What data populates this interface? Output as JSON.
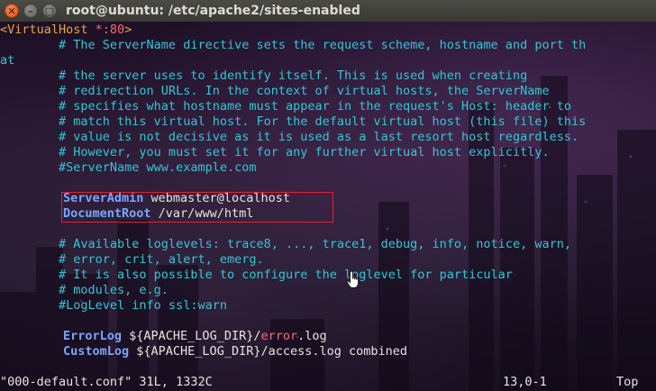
{
  "window": {
    "title": "root@ubuntu: /etc/apache2/sites-enabled",
    "close_glyph": "✕",
    "min_glyph": "–",
    "max_glyph": "□"
  },
  "editor": {
    "vhost_open": "<VirtualHost",
    "vhost_addr": " *:80",
    "vhost_close": ">",
    "comment_lines": [
      "        # The ServerName directive sets the request scheme, hostname and port th",
      "at",
      "        # the server uses to identify itself. This is used when creating",
      "        # redirection URLs. In the context of virtual hosts, the ServerName",
      "        # specifies what hostname must appear in the request's Host: header to",
      "        # match this virtual host. For the default virtual host (this file) this",
      "        # value is not decisive as it is used as a last resort host regardless.",
      "        # However, you must set it for any further virtual host explicitly.",
      "        #ServerName www.example.com"
    ],
    "server_admin_key": "ServerAdmin",
    "server_admin_value": " webmaster@localhost",
    "document_root_key": "DocumentRoot",
    "document_root_value": " /var/www/html",
    "loglevel_comments": [
      "        # Available loglevels: trace8, ..., trace1, debug, info, notice, warn,",
      "        # error, crit, alert, emerg.",
      "        # It is also possible to configure the loglevel for particular",
      "        # modules, e.g.",
      "        #LogLevel info ssl:warn"
    ],
    "error_log_key": "ErrorLog",
    "error_log_mid": " ${APACHE_LOG_DIR}/",
    "error_log_file": "error",
    "error_log_ext": ".log",
    "custom_log_key": "CustomLog",
    "custom_log_value": " ${APACHE_LOG_DIR}/access.log combined"
  },
  "status": {
    "file_info": "\"000-default.conf\" 31L, 1332C",
    "position": "13,0-1",
    "scroll": "Top"
  },
  "colors": {
    "comment": "#33c6d6",
    "keyword": "#7aa6ff",
    "tag": "#e2a84a",
    "highlight_box": "#e3242b"
  }
}
